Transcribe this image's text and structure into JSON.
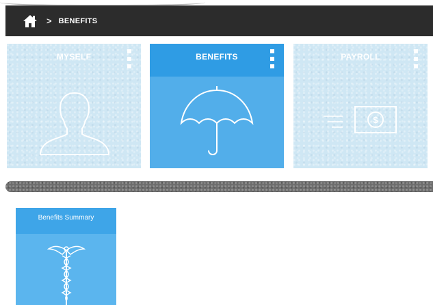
{
  "breadcrumb": {
    "home_icon": "home-icon",
    "separator": ">",
    "current": "BENEFITS"
  },
  "tiles": [
    {
      "title": "MYSELF",
      "icon": "person-silhouette-icon",
      "state": "inactive"
    },
    {
      "title": "BENEFITS",
      "icon": "umbrella-icon",
      "state": "active"
    },
    {
      "title": "PAYROLL",
      "icon": "money-bill-icon",
      "state": "inactive"
    }
  ],
  "subtiles": [
    {
      "title": "Benefits Summary",
      "icon": "caduceus-icon"
    }
  ],
  "colors": {
    "navbar": "#2c2c2c",
    "active_tile": "#52aeea",
    "active_tile_header": "#2f9ce4",
    "inactive_tile": "#cfe7f4",
    "divider": "#6d6d6d"
  }
}
